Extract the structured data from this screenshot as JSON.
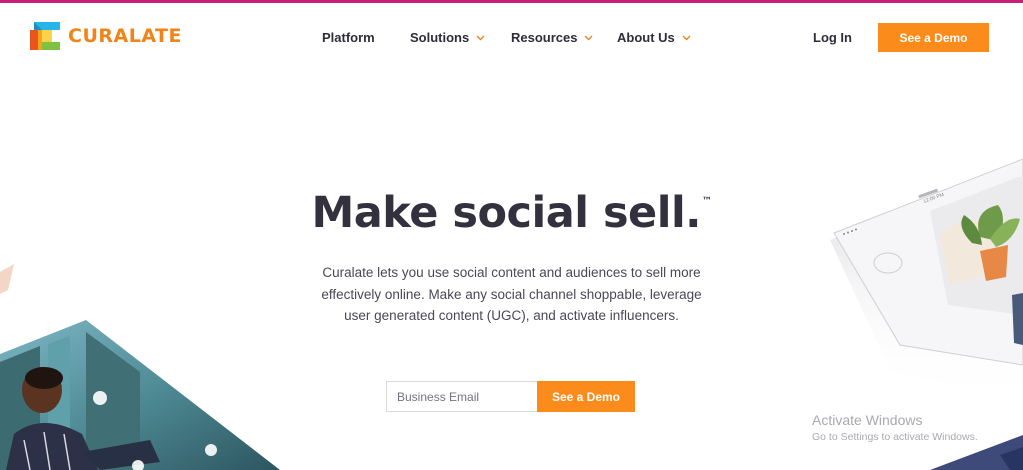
{
  "brand": {
    "name": "CURALATE",
    "accent": "#fb8c1c",
    "topbar_color": "#c81f78"
  },
  "nav": {
    "items": [
      {
        "label": "Platform",
        "has_dropdown": false
      },
      {
        "label": "Solutions",
        "has_dropdown": true
      },
      {
        "label": "Resources",
        "has_dropdown": true
      },
      {
        "label": "About Us",
        "has_dropdown": true
      }
    ],
    "login": "Log In",
    "cta": "See a Demo"
  },
  "hero": {
    "headline": "Make social sell.",
    "trademark": "™",
    "description": "Curalate lets you use social content and audiences to sell more effectively online. Make any social channel shoppable, leverage user generated content (UGC), and activate influencers.",
    "email_placeholder": "Business Email",
    "cta": "See a Demo"
  },
  "device": {
    "status_time": "12:00 PM"
  },
  "watermark": {
    "title": "Activate Windows",
    "subtitle": "Go to Settings to activate Windows."
  }
}
